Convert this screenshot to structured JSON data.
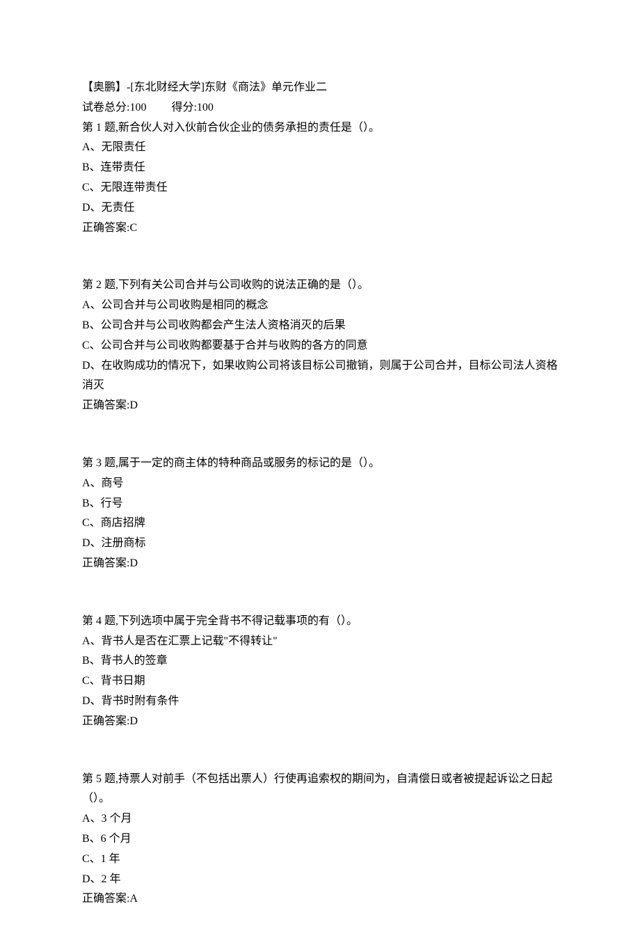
{
  "header": {
    "title": "【奥鹏】-[东北财经大学]东财《商法》单元作业二",
    "score_total_label": "试卷总分:",
    "score_total_value": "100",
    "score_obtained_label": "得分:",
    "score_obtained_value": "100"
  },
  "questions": [
    {
      "prompt": "第 1 题,新合伙人对入伙前合伙企业的债务承担的责任是（）。",
      "options": [
        "A、无限责任",
        "B、连带责任",
        "C、无限连带责任",
        "D、无责任"
      ],
      "answer_label": "正确答案:",
      "answer_value": "C"
    },
    {
      "prompt": "第 2 题,下列有关公司合并与公司收购的说法正确的是（）。",
      "options": [
        "A、公司合并与公司收购是相同的概念",
        "B、公司合并与公司收购都会产生法人资格消灭的后果",
        "C、公司合并与公司收购都要基于合并与收购的各方的同意",
        "D、在收购成功的情况下，如果收购公司将该目标公司撤销，则属于公司合并，目标公司法人资格消灭"
      ],
      "answer_label": "正确答案:",
      "answer_value": "D"
    },
    {
      "prompt": "第 3 题,属于一定的商主体的特种商品或服务的标记的是（）。",
      "options": [
        "A、商号",
        "B、行号",
        "C、商店招牌",
        "D、注册商标"
      ],
      "answer_label": "正确答案:",
      "answer_value": "D"
    },
    {
      "prompt": "第 4 题,下列选项中属于完全背书不得记载事项的有（）。",
      "options": [
        "A、背书人是否在汇票上记载\"不得转让\"",
        "B、背书人的签章",
        "C、背书日期",
        "D、背书时附有条件"
      ],
      "answer_label": "正确答案:",
      "answer_value": "D"
    },
    {
      "prompt": "第 5 题,持票人对前手（不包括出票人）行使再追索权的期间为，自清偿日或者被提起诉讼之日起（）。",
      "options": [
        "A、3 个月",
        "B、6 个月",
        "C、1 年",
        "D、2 年"
      ],
      "answer_label": "正确答案:",
      "answer_value": "A"
    }
  ]
}
